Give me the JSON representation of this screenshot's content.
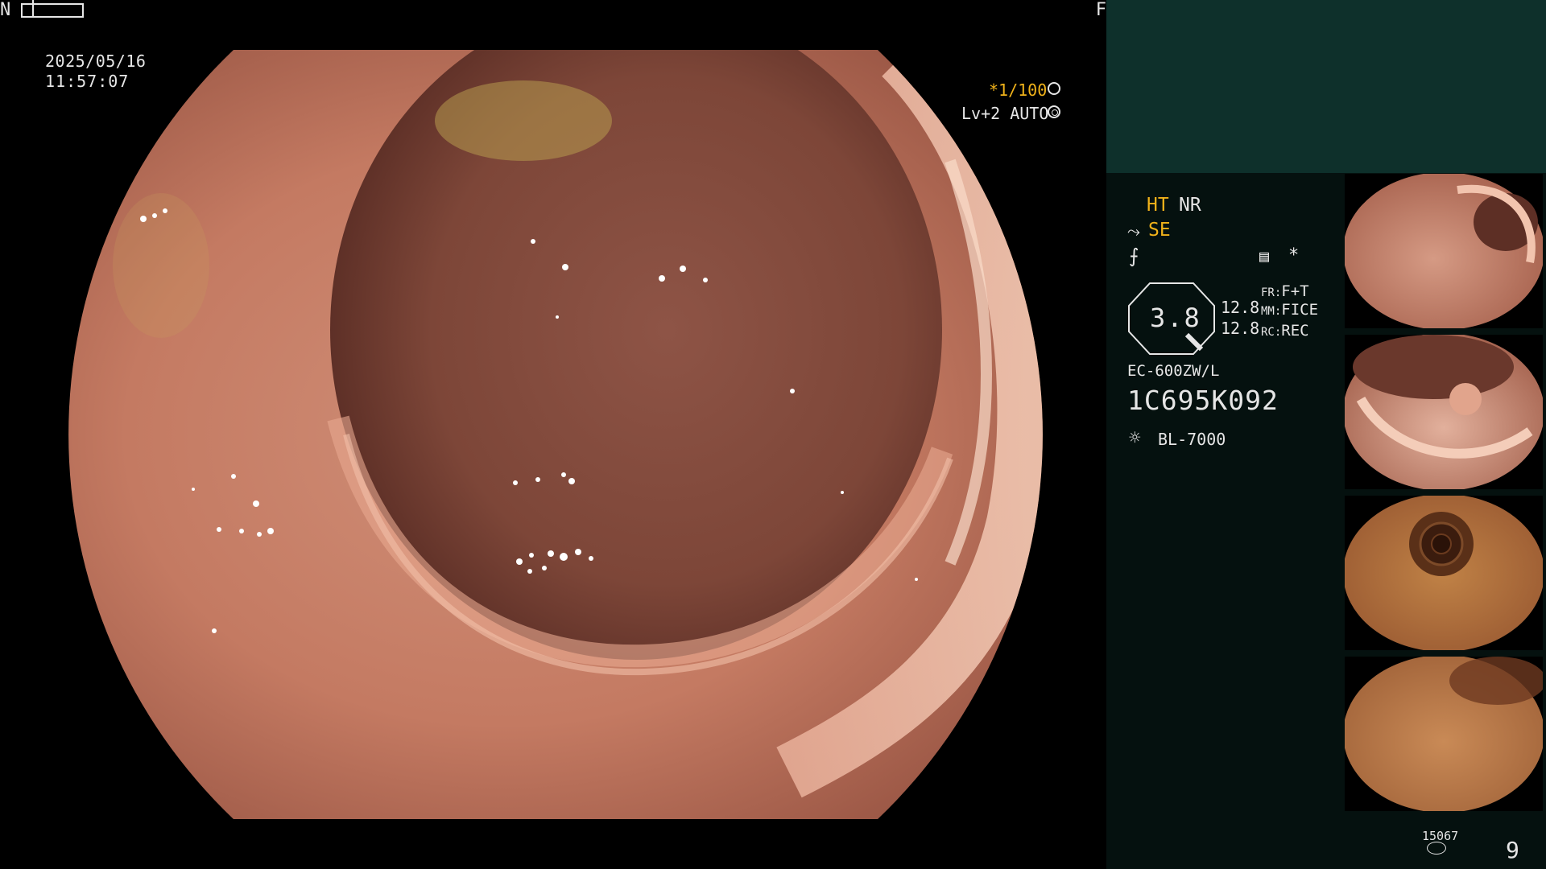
{
  "osd": {
    "date": "2025/05/16",
    "time": "11:57:07",
    "focus_near": "N",
    "focus_far": "F",
    "shutter": "*1/100",
    "level": "Lv+2 AUTO"
  },
  "panel": {
    "ht": "HT",
    "nr": "NR",
    "se": "SE",
    "star": "*",
    "zoom": "3.8",
    "num1": "12.8",
    "num2": "12.8",
    "fr_label": "FR:",
    "fr_value": "F+T",
    "mm_label": "MM:",
    "mm_value": "FICE",
    "rc_label": "RC:",
    "rc_value": "REC",
    "scope_model": "EC-600ZW/L",
    "scope_serial": "1C695K092",
    "light_source": "BL-7000",
    "image_count": "15067",
    "page_number": "9"
  },
  "colors": {
    "osd_accent": "#f0b21a",
    "panel_bg": "#05110f",
    "panel_header_bg": "#0e302b",
    "mucosa": "#c9826c"
  },
  "icons": [
    "shutter-icon",
    "auto-iris-icon",
    "structure-enhance-icon",
    "tone-curve-icon",
    "grid-icon",
    "light-source-icon",
    "storage-icon"
  ]
}
